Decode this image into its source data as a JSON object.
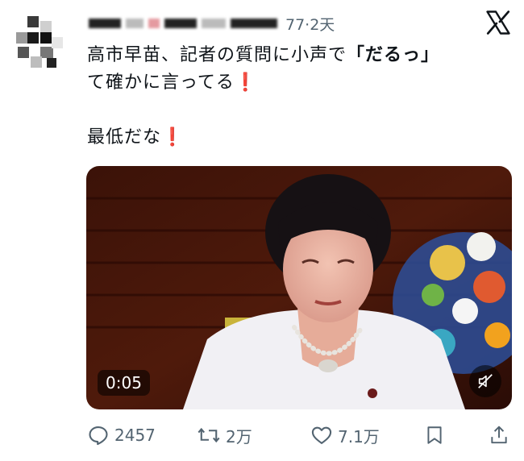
{
  "header": {
    "time": "77·2天"
  },
  "tweet": {
    "line1_plain": "高市早苗、記者の質問に小声で",
    "line1_bold": "「だるっ」",
    "line2_plain": "て確かに言ってる",
    "line3_plain": "最低だな",
    "exclamation": "❗"
  },
  "video": {
    "duration": "0:05"
  },
  "actions": {
    "replies": "2457",
    "retweets": "2万",
    "likes": "7.1万"
  },
  "icons": [
    "x-logo-icon",
    "mute-icon",
    "reply-icon",
    "retweet-icon",
    "like-icon",
    "bookmark-icon",
    "share-icon"
  ],
  "colors": {
    "exclamation": "#d51f26",
    "muted_text": "#536471"
  }
}
